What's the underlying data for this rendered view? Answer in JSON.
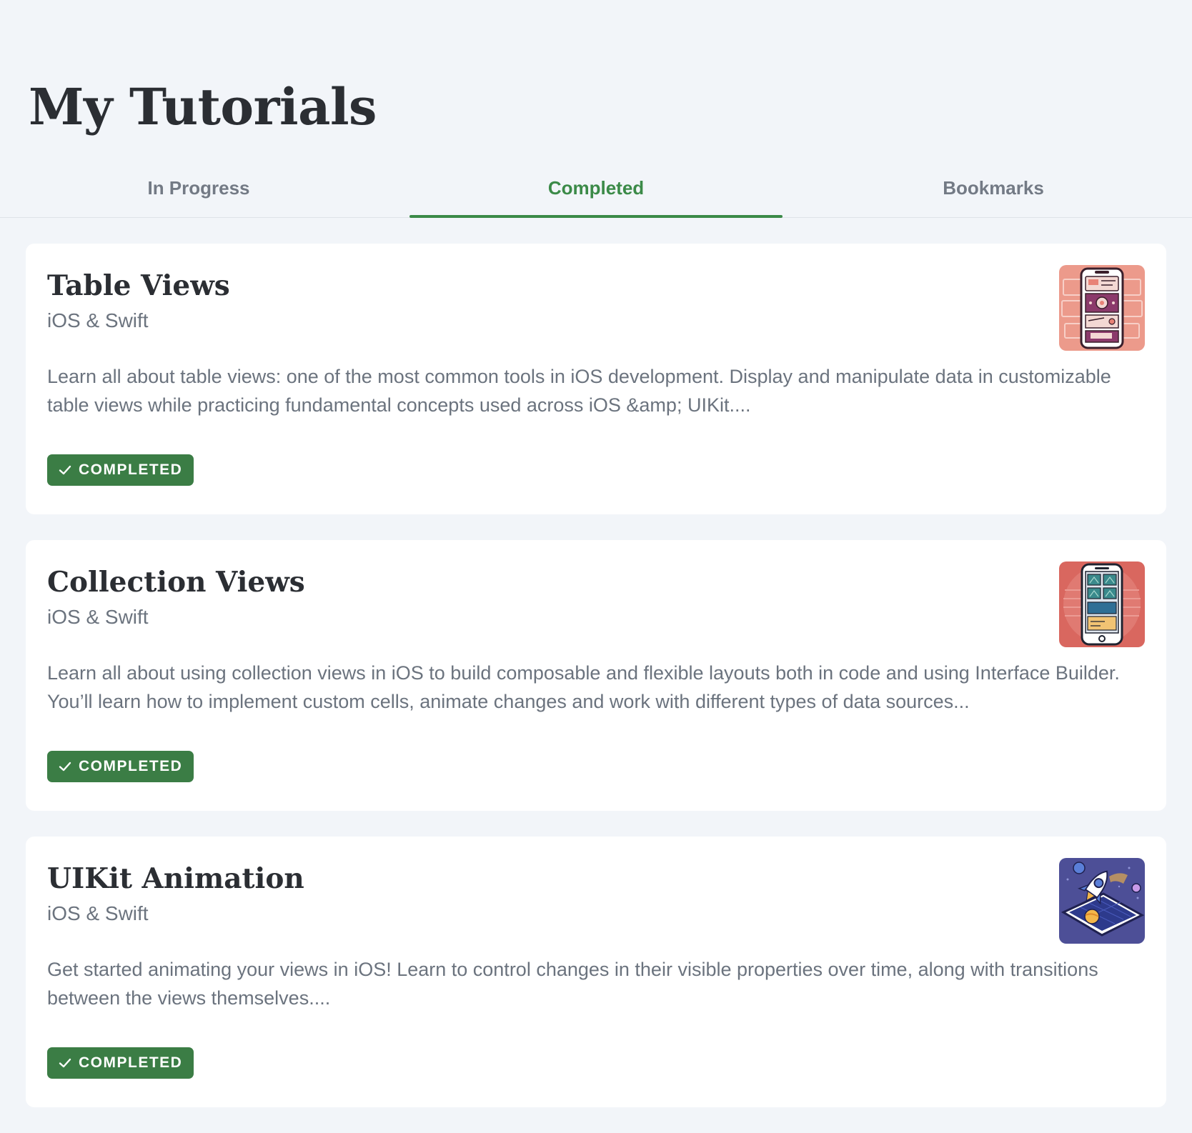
{
  "page": {
    "title": "My Tutorials"
  },
  "tabs": [
    {
      "label": "In Progress",
      "active": false
    },
    {
      "label": "Completed",
      "active": true
    },
    {
      "label": "Bookmarks",
      "active": false
    }
  ],
  "colors": {
    "accent": "#3b8a48",
    "badge": "#3b7d45",
    "background": "#f2f5f9"
  },
  "tutorials": [
    {
      "title": "Table Views",
      "category": "iOS & Swift",
      "description": "Learn all about table views: one of the most common tools in iOS development. Display and manipulate data in customizable table views while practicing fundamental concepts used across iOS &amp; UIKit....",
      "status": "COMPLETED",
      "thumbnail_icon": "phone-list-illustration-icon",
      "thumbnail_color": "#ec9a8b"
    },
    {
      "title": "Collection Views",
      "category": "iOS & Swift",
      "description": "Learn all about using collection views in iOS to build composable and flexible layouts both in code and using Interface Builder.  You’ll learn how to implement custom cells, animate changes and work with different types of data sources...",
      "status": "COMPLETED",
      "thumbnail_icon": "phone-grid-illustration-icon",
      "thumbnail_color": "#d9675f"
    },
    {
      "title": "UIKit Animation",
      "category": "iOS & Swift",
      "description": "Get started animating your views in iOS! Learn to control changes in their visible properties over time, along with transitions between the views themselves....",
      "status": "COMPLETED",
      "thumbnail_icon": "rocket-phone-illustration-icon",
      "thumbnail_color": "#4d4f97"
    }
  ]
}
